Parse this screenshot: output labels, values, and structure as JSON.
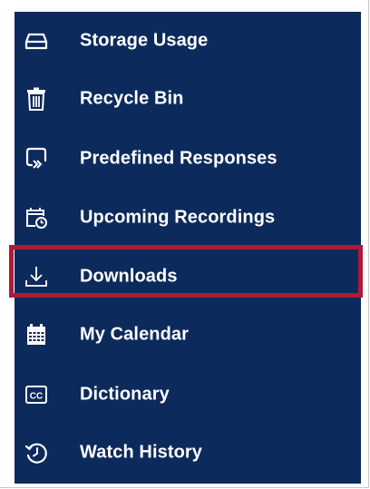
{
  "menu": {
    "items": [
      {
        "label": "Storage Usage",
        "icon": "hard-drive-icon"
      },
      {
        "label": "Recycle Bin",
        "icon": "trash-icon"
      },
      {
        "label": "Predefined Responses",
        "icon": "response-arrow-icon"
      },
      {
        "label": "Upcoming Recordings",
        "icon": "calendar-clock-icon"
      },
      {
        "label": "Downloads",
        "icon": "download-icon",
        "highlighted": true
      },
      {
        "label": "My Calendar",
        "icon": "calendar-grid-icon"
      },
      {
        "label": "Dictionary",
        "icon": "closed-caption-icon"
      },
      {
        "label": "Watch History",
        "icon": "history-icon"
      }
    ]
  },
  "colors": {
    "menu_background": "#0c2a5b",
    "text": "#ffffff",
    "highlight_border": "#b01937"
  }
}
